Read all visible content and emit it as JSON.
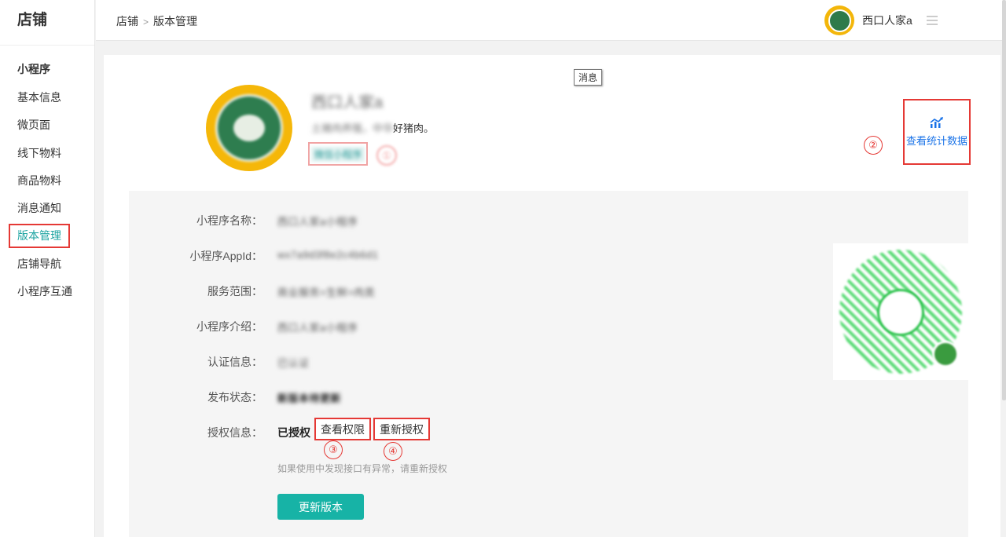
{
  "sidebar": {
    "brand": "店铺",
    "group_title": "小程序",
    "items": [
      {
        "label": "基本信息"
      },
      {
        "label": "微页面"
      },
      {
        "label": "线下物料"
      },
      {
        "label": "商品物料"
      },
      {
        "label": "消息通知"
      },
      {
        "label": "版本管理",
        "active": true
      },
      {
        "label": "店铺导航"
      },
      {
        "label": "小程序互通"
      }
    ]
  },
  "header": {
    "breadcrumb": [
      "店铺",
      "版本管理"
    ],
    "breadcrumb_separator": ">",
    "user_name": "西口人家a",
    "menu_icon": "hamburger-icon"
  },
  "tooltip": "消息",
  "app": {
    "title": "西口人家a",
    "description_blurred": "土猪肉养殖，中华",
    "description_tail": "好猪肉。",
    "tag": "微信小程序",
    "tag_badge": "①"
  },
  "stats": {
    "icon": "chart-trend-icon",
    "label": "查看统计数据"
  },
  "annotations": [
    "②",
    "③",
    "④"
  ],
  "info": {
    "name_label": "小程序名称：",
    "name_value": "西口人家a小程序",
    "appid_label": "小程序AppId：",
    "appid_value": "wx7a9d3f8e2c4b6d1",
    "scope_label": "服务范围：",
    "scope_value": "商业服务>生鲜>肉类",
    "intro_label": "小程序介绍：",
    "intro_value": "西口人家a小程序",
    "cert_label": "认证信息：",
    "cert_value": "已认证",
    "publish_label": "发布状态：",
    "publish_value": "新版本待更新",
    "auth_label": "授权信息：",
    "auth_state": "已授权",
    "view_permission": "查看权限",
    "reauthorize": "重新授权",
    "hint": "如果使用中发现接口有异常，请重新授权"
  },
  "update_button": "更新版本",
  "colors": {
    "accent": "#17b3a6",
    "link": "#1a73e8",
    "annotation_red": "#e53935"
  }
}
